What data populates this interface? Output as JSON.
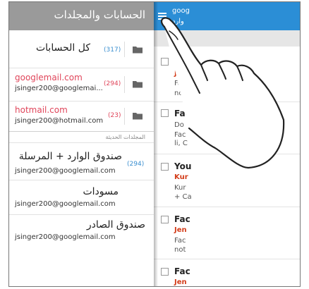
{
  "drawer": {
    "title": "الحسابات والمجلدات",
    "all_accounts": {
      "label": "كل الحسابات",
      "count": "(317)"
    },
    "accounts": [
      {
        "name": "googlemail.com",
        "email": "jsinger200@googlemai...",
        "count": "(294)"
      },
      {
        "name": "hotmail.com",
        "email": "jsinger200@hotmail.com",
        "count": "(23)"
      }
    ],
    "recent_label": "المجلدات الحديثة",
    "folders": [
      {
        "label": "صندوق الوارد + المرسلة",
        "email": "jsinger200@googlemail.com",
        "count": "(294)"
      },
      {
        "label": "مسودات",
        "email": "jsinger200@googlemail.com"
      },
      {
        "label": "صندوق الصادر",
        "email": "jsinger200@googlemail.com"
      }
    ]
  },
  "inbox": {
    "account": "goog",
    "subtitle": "وارد",
    "messages": [
      {
        "sender": "Je",
        "line1": "Fac",
        "line2": "not"
      },
      {
        "from": "Fac",
        "line1": "Do",
        "line2": "Fac",
        "line3": "li, C"
      },
      {
        "from": "You",
        "sender": "Kur",
        "line1": "Kur",
        "line2": "+ Ca"
      },
      {
        "from": "Fac",
        "sender": "Jen",
        "line1": "Fac",
        "line2": "not"
      },
      {
        "from": "Fac",
        "sender": "Jen"
      }
    ]
  },
  "colors": {
    "drawer_header": "#9a9a9a",
    "inbox_header": "#2b8ed6",
    "account_name": "#e0455a",
    "count": "#3a8fd0",
    "sender": "#d33c19"
  }
}
